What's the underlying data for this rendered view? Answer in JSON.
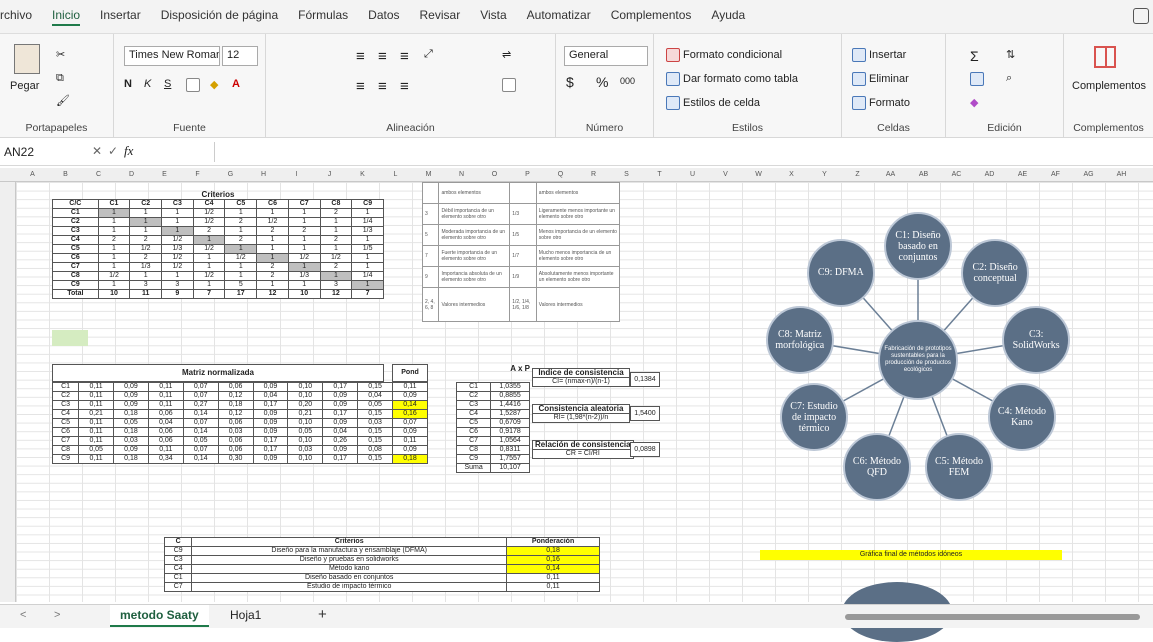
{
  "menu": [
    "Archivo",
    "Inicio",
    "Insertar",
    "Disposición de página",
    "Fórmulas",
    "Datos",
    "Revisar",
    "Vista",
    "Automatizar",
    "Complementos",
    "Ayuda"
  ],
  "ribbon": {
    "portapapeles": {
      "pegar": "Pegar",
      "label": "Portapapeles"
    },
    "fuente": {
      "font": "Times New Roman",
      "size": "12",
      "label": "Fuente"
    },
    "alineacion": {
      "label": "Alineación"
    },
    "numero": {
      "format": "General",
      "label": "Número"
    },
    "estilos": {
      "cond": "Formato condicional",
      "tabla": "Dar formato como tabla",
      "celda": "Estilos de celda",
      "label": "Estilos"
    },
    "celdas": {
      "insertar": "Insertar",
      "eliminar": "Eliminar",
      "formato": "Formato",
      "label": "Celdas"
    },
    "edicion": {
      "label": "Edición"
    },
    "complementos": {
      "btn": "Complementos",
      "label": "Complementos"
    }
  },
  "formula_bar": {
    "cell": "AN22",
    "fx": "fx"
  },
  "columns": [
    "A",
    "B",
    "C",
    "D",
    "E",
    "F",
    "G",
    "H",
    "I",
    "J",
    "K",
    "L",
    "M",
    "N",
    "O",
    "P",
    "Q",
    "R",
    "S",
    "T",
    "U",
    "V",
    "W",
    "X",
    "Y",
    "Z",
    "AA",
    "AB",
    "AC",
    "AD",
    "AE",
    "AF",
    "AG",
    "AH"
  ],
  "criterios": {
    "title": "Criterios",
    "header": [
      "C/C",
      "C1",
      "C2",
      "C3",
      "C4",
      "C5",
      "C6",
      "C7",
      "C8",
      "C9"
    ],
    "rows": [
      [
        "C1",
        "1",
        "1",
        "1",
        "1/2",
        "1",
        "1",
        "1",
        "2",
        "1"
      ],
      [
        "C2",
        "1",
        "1",
        "1",
        "1/2",
        "2",
        "1/2",
        "1",
        "1",
        "1/4"
      ],
      [
        "C3",
        "1",
        "1",
        "1",
        "2",
        "1",
        "2",
        "2",
        "1",
        "1/3"
      ],
      [
        "C4",
        "2",
        "2",
        "1/2",
        "1",
        "2",
        "1",
        "1",
        "2",
        "1"
      ],
      [
        "C5",
        "1",
        "1/2",
        "1/3",
        "1/2",
        "1",
        "1",
        "1",
        "1",
        "1/5"
      ],
      [
        "C6",
        "1",
        "2",
        "1/2",
        "1",
        "1/2",
        "1",
        "1/2",
        "1/2",
        "1"
      ],
      [
        "C7",
        "1",
        "1/3",
        "1/2",
        "1",
        "1",
        "2",
        "1",
        "2",
        "1"
      ],
      [
        "C8",
        "1/2",
        "1",
        "1",
        "1/2",
        "1",
        "2",
        "1/3",
        "1",
        "1/4"
      ],
      [
        "C9",
        "1",
        "3",
        "3",
        "1",
        "5",
        "1",
        "1",
        "3",
        "1"
      ],
      [
        "Total",
        "10",
        "11",
        "9",
        "7",
        "17",
        "12",
        "10",
        "12",
        "7"
      ]
    ]
  },
  "normalizada": {
    "title": "Matriz normalizada",
    "pond_label": "Pond",
    "rows": [
      [
        "C1",
        "0,11",
        "0,09",
        "0,11",
        "0,07",
        "0,06",
        "0,09",
        "0,10",
        "0,17",
        "0,15",
        "0,11"
      ],
      [
        "C2",
        "0,11",
        "0,09",
        "0,11",
        "0,07",
        "0,12",
        "0,04",
        "0,10",
        "0,09",
        "0,04",
        "0,09"
      ],
      [
        "C3",
        "0,11",
        "0,09",
        "0,11",
        "0,27",
        "0,18",
        "0,17",
        "0,20",
        "0,09",
        "0,05",
        "0,14"
      ],
      [
        "C4",
        "0,21",
        "0,18",
        "0,06",
        "0,14",
        "0,12",
        "0,09",
        "0,21",
        "0,17",
        "0,15",
        "0,16"
      ],
      [
        "C5",
        "0,11",
        "0,05",
        "0,04",
        "0,07",
        "0,06",
        "0,09",
        "0,10",
        "0,09",
        "0,03",
        "0,07"
      ],
      [
        "C6",
        "0,11",
        "0,18",
        "0,06",
        "0,14",
        "0,03",
        "0,09",
        "0,05",
        "0,04",
        "0,15",
        "0,09"
      ],
      [
        "C7",
        "0,11",
        "0,03",
        "0,06",
        "0,05",
        "0,06",
        "0,17",
        "0,10",
        "0,26",
        "0,15",
        "0,11"
      ],
      [
        "C8",
        "0,05",
        "0,09",
        "0,11",
        "0,07",
        "0,06",
        "0,17",
        "0,03",
        "0,09",
        "0,08",
        "0,09"
      ],
      [
        "C9",
        "0,11",
        "0,18",
        "0,34",
        "0,14",
        "0,30",
        "0,09",
        "0,10",
        "0,17",
        "0,15",
        "0,18"
      ]
    ]
  },
  "axp": {
    "title": "A x P",
    "rows": [
      [
        "C1",
        "1,0355"
      ],
      [
        "C2",
        "0,8855"
      ],
      [
        "C3",
        "1,4416"
      ],
      [
        "C4",
        "1,5287"
      ],
      [
        "C5",
        "0,6709"
      ],
      [
        "C6",
        "0,9178"
      ],
      [
        "C7",
        "1,0564"
      ],
      [
        "C8",
        "0,8311"
      ],
      [
        "C9",
        "1,7557"
      ],
      [
        "Suma",
        "10,107"
      ]
    ]
  },
  "indices": {
    "ic_title": "Índice de consistencia",
    "ic_formula": "CI= (nmax-n)/(n-1)",
    "ic_value": "0,1384",
    "ia_title": "Consistencia aleatoria",
    "ia_formula": "RI= (1,98*(n-2))/n",
    "ia_value": "1,5400",
    "rc_title": "Relación de consistencia",
    "rc_formula": "CR = CI/RI",
    "rc_value": "0,0898"
  },
  "scale": [
    {
      "n": "",
      "desc": "ambos elementos",
      "rec": "",
      "desc2": "ambos elementos"
    },
    {
      "n": "3",
      "desc": "Débil importancia de un elemento sobre otro",
      "rec": "1/3",
      "desc2": "Ligeramente menos importante un elemento sobre otro"
    },
    {
      "n": "5",
      "desc": "Moderada importancia de un elemento sobre otro",
      "rec": "1/5",
      "desc2": "Menos importancia de un elemento sobre otro"
    },
    {
      "n": "7",
      "desc": "Fuerte importancia de un elemento sobre otro",
      "rec": "1/7",
      "desc2": "Mucho menos importancia de un elemento sobre otro"
    },
    {
      "n": "9",
      "desc": "Importancia absoluta de un elemento sobre otro",
      "rec": "1/9",
      "desc2": "Absolutamente menos importante un elemento sobre otro"
    },
    {
      "n": "2, 4, 6, 8",
      "desc": "Valores intermedios",
      "rec": "1/2, 1/4, 1/6, 1/8",
      "desc2": "Valores intermedios"
    }
  ],
  "ranking": {
    "h1": "C",
    "h2": "Criterios",
    "h3": "Ponderación",
    "rows": [
      [
        "C9",
        "Diseño para la manufactura y ensamblaje (DFMA)",
        "0,18"
      ],
      [
        "C3",
        "Diseño y pruebas en solidworks",
        "0,16"
      ],
      [
        "C4",
        "Método kano",
        "0,14"
      ],
      [
        "C1",
        "Diseño basado en conjuntos",
        "0,11"
      ],
      [
        "C7",
        "Estudio de impacto térmico",
        "0,11"
      ]
    ]
  },
  "diagram": {
    "center": "Fabricación de prototipos sustentables para la producción de productos ecológicos",
    "nodes": [
      "C1: Diseño basado en conjuntos",
      "C2: Diseño conceptual",
      "C3: SolidWorks",
      "C4: Método Kano",
      "C5: Método FEM",
      "C6: Método QFD",
      "C7: Estudio de impacto térmico",
      "C8: Matriz morfológica",
      "C9: DFMA"
    ],
    "caption": "Gráfica final de métodos idóneos"
  },
  "sheets": [
    "metodo Saaty",
    "Hoja1"
  ],
  "add_sheet": "+",
  "colors": {
    "highlight": "#ffff00",
    "grey": "#bfbfbf",
    "bubble": "#5b6f86",
    "accent": "#1f7a4a"
  }
}
